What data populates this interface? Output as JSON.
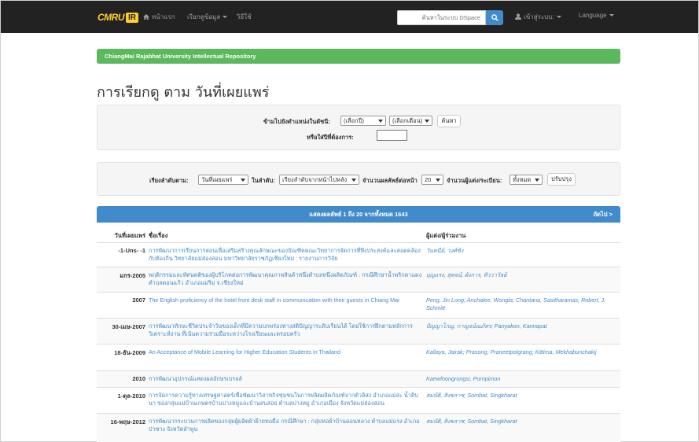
{
  "navbar": {
    "brand_text": "CMRU",
    "brand_badge": "IR",
    "home_label": "หน้าแรก",
    "browse_label": "เรียกดูข้อมูล",
    "help_label": "วิธีใช้",
    "search_placeholder": "ค้นหาในระบบ DSpace",
    "login_label": "เข้าสู่ระบบ:",
    "language_label": "Language"
  },
  "repository_name": "ChiangMai Rajabhat University Intellectual Repository",
  "page_title": "การเรียกดู ตาม วันที่เผยแพร่",
  "jump_form": {
    "jump_label": "ข้ามไปยังตำแหน่งในดัชนี:",
    "year_select": "(เลือกปี)",
    "month_select": "(เลือกเดือน)",
    "go_button": "ค้นหา",
    "year_type_label": "หรือใส่ปีที่ต้องการ:",
    "year_input_value": ""
  },
  "sort_form": {
    "sort_by_label": "เรียงลำดับตาม:",
    "sort_by_value": "วันที่เผยแพร่",
    "order_label": "ในลำดับ:",
    "order_value": "เรียงลำดับจากหน้าไปหลัง",
    "per_page_label": "จำนวนผลลัพธ์ต่อหน้า",
    "per_page_value": "20",
    "authors_label": "จำนวนผู้แต่ง/ระเบียน:",
    "authors_value": "ทั้งหมด",
    "update_button": "ปรับปรุง"
  },
  "results": {
    "summary": "แสดงผลลัพธ์ 1 ถึง 20 จากทั้งหมด 1643",
    "next_label": "ถัดไป >",
    "col_date": "วันที่เผยแพร่",
    "col_title": "ชื่อเรื่อง",
    "col_authors": "ผู้แต่ง/ผู้ร่วมงาน",
    "rows": [
      {
        "date": "-1-Uns- -1",
        "title": "การพัฒนาการเรียนการสอนเพื่อเสริมสร้างคุณลักษณะของบัณฑิตคณะวิทยาการจัดการที่พึงประสงค์และสอดคล้องกับท้องถิ่น วิทยาลัยแม่ฮ่องสอน มหาวิทยาลัยราชภัฏเชียงใหม่ : รายงานการวิจัย",
        "authors": "วันทนีย์, วงศ์ชัง"
      },
      {
        "date": "มกร-2005",
        "title": "พฤติกรรมและทัศนคติของผู้บริโภคต่อการพัฒนาคุณภาพสินค้าหนึ่งตำบลหนึ่งผลิตภัณฑ์ : กรณีศึกษาน้ำพริกตาแดง ตำบลดอนแก้ว อำเภอแม่ริม จ.เชียงใหม่",
        "authors": "บุญแรง, สุพจน์; ผังการ, ทิววาวัลย์"
      },
      {
        "date": "2007",
        "title": "The English proficiency of the hotel front desk staff in communication with their guests in Chiang Mai",
        "authors": "Peng, Jin Long; Anchalee, Wongla; Chantana, Sasitharamas; Robert, J. Schmitt"
      },
      {
        "date": "30-เมษ-2007",
        "title": "การพัฒนาทักษะชีวิตประจำวันของเด็กที่มีความบกพร่องทางสติปัญญาระดับเรียนได้ โดยใช้การฝึกตามหลักการวิเคราะห์งาน ที่เน้นความร่วมมือระหว่างโรงเรียนและครอบครัว",
        "authors": "ปัญญาโกญ, กาญจน์ณภัทร; Panyakon, Kannapat"
      },
      {
        "date": "18-ธัน-2009",
        "title": "An Acceptance of Mobile Learning for Higher Education Students in Thailand",
        "authors": "Kallaya, Jairak; Prasong, Praneetpolgrang; Kittima, Mekhabunchakij"
      },
      {
        "date": "2010",
        "title": "การพัฒนาอุปกรณ์แสดงผลอักษรเบรลล์",
        "authors": "Kaewfoongrungsi, Pornpimon"
      },
      {
        "date": "1-ตุล-2010",
        "title": "การจัดการความรู้ทางเศรษฐศาสตร์เพื่อพัฒนาวิสาหกิจชุมชนในการผลิตผลิตภัณฑ์จากตัวลิสง อำเภอแม่สะ น้ำดิบนา ของกลุ่มแม่บ้านเกษตรบ้านปางหมูและบ้านสบสอย ตำบลปางหมู อำเภอเมือง จังหวัดแม่ฮ่องสอน",
        "authors": "สมบัติ, สิงฆราช; Sombat, Singkharat"
      },
      {
        "date": "16-พฤษ-2012",
        "title": "การพัฒนากระบวนการผลิตของกลุ่มผู้ผลิตผ้าฝ้ายทอมือ กรณีศึกษา : กลุ่มทอผ้าบ้านดอนหลวง ตำบลแม่แรง อำเภอป่าซาง จังหวัดลำพูน",
        "authors": "สมบัติ, สิงฆราช; Sombat, Singkharat"
      }
    ]
  },
  "colors": {
    "navbar_bg": "#222222",
    "brand_yellow": "#ffcc33",
    "repo_bar": "#5cb85c",
    "panel_head": "#428bca",
    "link": "#428bca"
  }
}
